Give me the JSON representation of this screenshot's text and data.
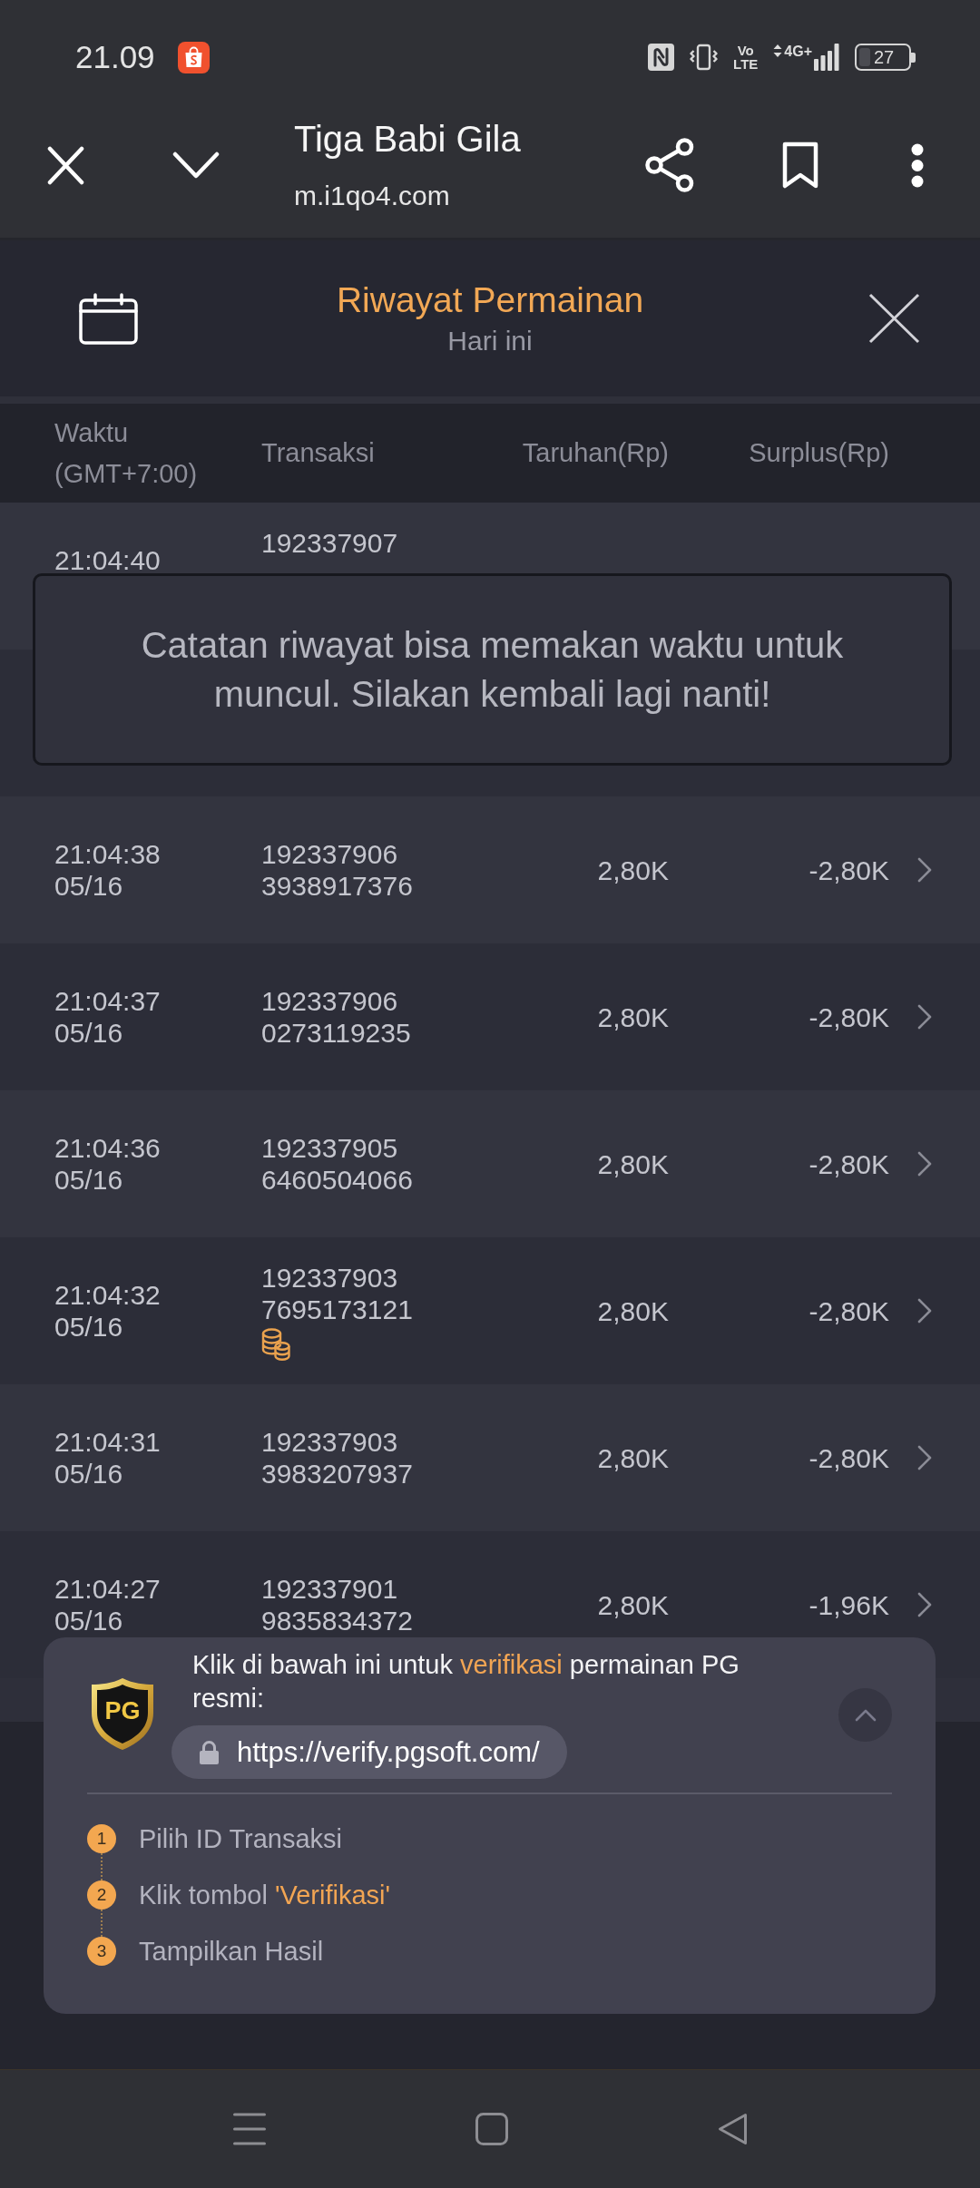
{
  "status_bar": {
    "time": "21.09",
    "volte": "Vo LTE",
    "network": "4G+",
    "battery": "27"
  },
  "browser": {
    "title": "Tiga Babi Gila",
    "url": "m.i1qo4.com"
  },
  "game_header": {
    "title": "Riwayat Permainan",
    "subtitle": "Hari ini"
  },
  "table": {
    "columns": [
      "Waktu (GMT+7:00)",
      "Transaksi",
      "Taruhan(Rp)",
      "Surplus(Rp)"
    ],
    "rows": [
      {
        "kind": "covered",
        "time": "21:04:40",
        "transaction": [
          "192337907"
        ]
      },
      {
        "kind": "covered"
      },
      {
        "kind": "full",
        "time": "21:04:38",
        "date": "05/16",
        "transaction": [
          "192337906",
          "3938917376"
        ],
        "bet": "2,80K",
        "surplus": "-2,80K",
        "coins": false
      },
      {
        "kind": "full",
        "time": "21:04:37",
        "date": "05/16",
        "transaction": [
          "192337906",
          "0273119235"
        ],
        "bet": "2,80K",
        "surplus": "-2,80K",
        "coins": false
      },
      {
        "kind": "full",
        "time": "21:04:36",
        "date": "05/16",
        "transaction": [
          "192337905",
          "6460504066"
        ],
        "bet": "2,80K",
        "surplus": "-2,80K",
        "coins": false
      },
      {
        "kind": "full",
        "time": "21:04:32",
        "date": "05/16",
        "transaction": [
          "192337903",
          "7695173121"
        ],
        "bet": "2,80K",
        "surplus": "-2,80K",
        "coins": true
      },
      {
        "kind": "full",
        "time": "21:04:31",
        "date": "05/16",
        "transaction": [
          "192337903",
          "3983207937"
        ],
        "bet": "2,80K",
        "surplus": "-2,80K",
        "coins": false
      },
      {
        "kind": "full",
        "time": "21:04:27",
        "date": "05/16",
        "transaction": [
          "192337901",
          "9835834372"
        ],
        "bet": "2,80K",
        "surplus": "-1,96K",
        "coins": false
      }
    ]
  },
  "notice": {
    "text": "Catatan riwayat bisa memakan waktu untuk muncul. Silakan kembali lagi nanti!"
  },
  "verify_panel": {
    "expanded": true,
    "logo": "PG",
    "message": [
      {
        "text": "Klik di bawah ini untuk ",
        "highlight": false
      },
      {
        "text": "verifikasi",
        "highlight": true
      },
      {
        "text": " permainan PG resmi:",
        "highlight": false
      }
    ],
    "url": "https://verify.pgsoft.com/",
    "steps": [
      {
        "number": "1",
        "parts": [
          {
            "text": "Pilih ID Transaksi",
            "highlight": false
          }
        ]
      },
      {
        "number": "2",
        "parts": [
          {
            "text": "Klik tombol ",
            "highlight": false
          },
          {
            "text": "'Verifikasi'",
            "highlight": true
          }
        ]
      },
      {
        "number": "3",
        "parts": [
          {
            "text": "Tampilkan Hasil",
            "highlight": false
          }
        ]
      }
    ]
  }
}
